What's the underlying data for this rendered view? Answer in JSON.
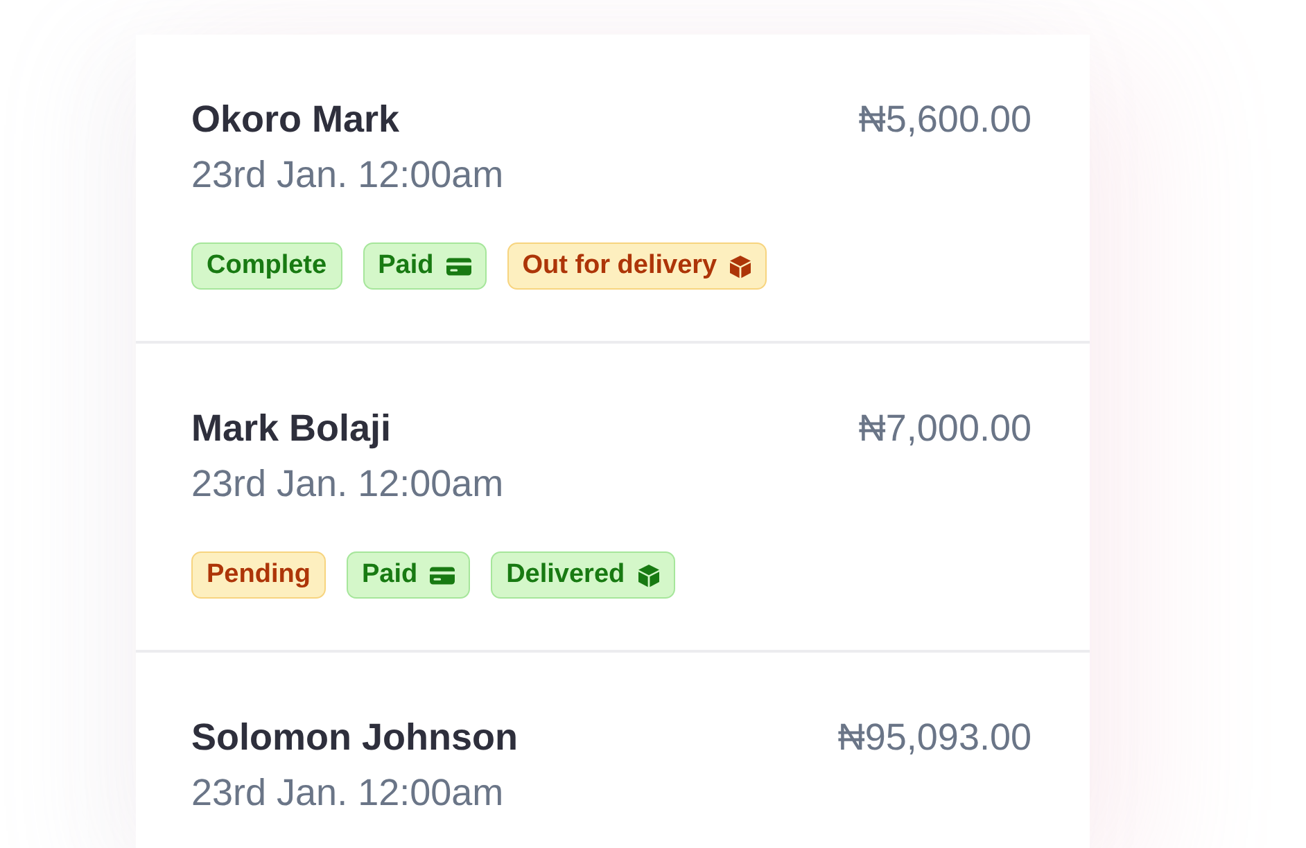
{
  "orders": [
    {
      "customer": "Okoro Mark",
      "amount": "₦5,600.00",
      "date": "23rd Jan. 12:00am",
      "badges": [
        {
          "label": "Complete",
          "kind": "status",
          "color": "#d4f7c9"
        },
        {
          "label": "Paid",
          "kind": "payment",
          "color": "#d4f7c9"
        },
        {
          "label": "Out for delivery",
          "kind": "delivery",
          "color": "#fdefbf"
        }
      ]
    },
    {
      "customer": "Mark Bolaji",
      "amount": "₦7,000.00",
      "date": "23rd Jan. 12:00am",
      "badges": [
        {
          "label": "Pending",
          "kind": "status",
          "color": "#fdefbf"
        },
        {
          "label": "Paid",
          "kind": "payment",
          "color": "#d4f7c9"
        },
        {
          "label": "Delivered",
          "kind": "delivery",
          "color": "#d4f7c9"
        }
      ]
    },
    {
      "customer": "Solomon Johnson",
      "amount": "₦95,093.00",
      "date": "23rd Jan. 12:00am"
    }
  ]
}
